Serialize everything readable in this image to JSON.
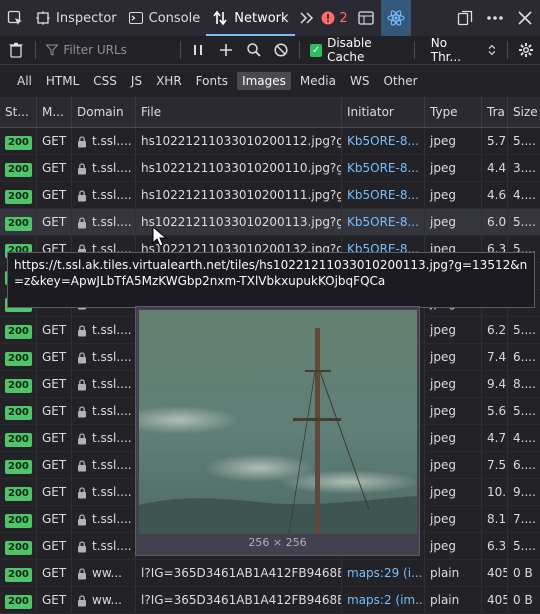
{
  "devtools": {
    "tabs": [
      {
        "label": "Inspector"
      },
      {
        "label": "Console"
      },
      {
        "label": "Network"
      }
    ],
    "error_count": "2"
  },
  "toolbar": {
    "filter_placeholder": "Filter URLs",
    "disable_cache_label": "Disable Cache",
    "throttle_label": "No Thr..."
  },
  "filters": [
    "All",
    "HTML",
    "CSS",
    "JS",
    "XHR",
    "Fonts",
    "Images",
    "Media",
    "WS",
    "Other"
  ],
  "active_filter": "Images",
  "columns": [
    "St...",
    "M...",
    "Domain",
    "File",
    "Initiator",
    "Type",
    "Tra",
    "Size"
  ],
  "rows": [
    {
      "status": "200",
      "method": "GET",
      "domain": "t.ssl....",
      "file": "hs10221211033010200112.jpg?g=13",
      "initiator": "Kb5ORE-8...",
      "type": "jpeg",
      "transferred": "5.7",
      "size": "5...."
    },
    {
      "status": "200",
      "method": "GET",
      "domain": "t.ssl....",
      "file": "hs10221211033010200110.jpg?g=13",
      "initiator": "Kb5ORE-8...",
      "type": "jpeg",
      "transferred": "4.4",
      "size": "3...."
    },
    {
      "status": "200",
      "method": "GET",
      "domain": "t.ssl....",
      "file": "hs10221211033010200111.jpg?g=13",
      "initiator": "Kb5ORE-8...",
      "type": "jpeg",
      "transferred": "4.6",
      "size": "4...."
    },
    {
      "status": "200",
      "method": "GET",
      "domain": "t.ssl....",
      "file": "hs10221211033010200113.jpg?g=13",
      "initiator": "Kb5ORE-8...",
      "type": "jpeg",
      "transferred": "6.0",
      "size": "5...."
    },
    {
      "status": "200",
      "method": "GET",
      "domain": "t.ssl....",
      "file": "hs10221211033010200132.jpg?g=13",
      "initiator": "Kb5ORE-8...",
      "type": "jpeg",
      "transferred": "6.3",
      "size": "5...."
    },
    {
      "status": "200",
      "method": "GET",
      "domain": "t.ssl....",
      "file": "",
      "initiator": "",
      "type": "jpeg",
      "transferred": "",
      "size": ""
    },
    {
      "status": "200",
      "method": "GET",
      "domain": "t.ssl....",
      "file": "",
      "initiator": "",
      "type": "jpeg",
      "transferred": "",
      "size": ""
    },
    {
      "status": "200",
      "method": "GET",
      "domain": "t.ssl....",
      "file": "",
      "initiator": "",
      "type": "jpeg",
      "transferred": "6.2",
      "size": "5...."
    },
    {
      "status": "200",
      "method": "GET",
      "domain": "t.ssl....",
      "file": "",
      "initiator": "",
      "type": "jpeg",
      "transferred": "7.4",
      "size": "6...."
    },
    {
      "status": "200",
      "method": "GET",
      "domain": "t.ssl....",
      "file": "",
      "initiator": "",
      "type": "jpeg",
      "transferred": "9.4",
      "size": "8...."
    },
    {
      "status": "200",
      "method": "GET",
      "domain": "t.ssl....",
      "file": "",
      "initiator": "",
      "type": "jpeg",
      "transferred": "5.6",
      "size": "5...."
    },
    {
      "status": "200",
      "method": "GET",
      "domain": "t.ssl....",
      "file": "",
      "initiator": "",
      "type": "jpeg",
      "transferred": "4.7",
      "size": "4...."
    },
    {
      "status": "200",
      "method": "GET",
      "domain": "t.ssl....",
      "file": "",
      "initiator": "",
      "type": "jpeg",
      "transferred": "7.5",
      "size": "6...."
    },
    {
      "status": "200",
      "method": "GET",
      "domain": "t.ssl....",
      "file": "",
      "initiator": "",
      "type": "jpeg",
      "transferred": "10.",
      "size": "9...."
    },
    {
      "status": "200",
      "method": "GET",
      "domain": "t.ssl....",
      "file": "",
      "initiator": "",
      "type": "jpeg",
      "transferred": "8.1",
      "size": "7...."
    },
    {
      "status": "200",
      "method": "GET",
      "domain": "t.ssl....",
      "file": "",
      "initiator": "",
      "type": "jpeg",
      "transferred": "6.3",
      "size": "5...."
    },
    {
      "status": "200",
      "method": "GET",
      "domain": "ww...",
      "file": "l?IG=365D3461AB1A412FB9468B1C",
      "initiator": "maps:29 (i...",
      "type": "plain",
      "transferred": "405",
      "size": "0 B"
    },
    {
      "status": "200",
      "method": "GET",
      "domain": "ww...",
      "file": "l?IG=365D3461AB1A412FB9468B1C",
      "initiator": "maps:2 (im...",
      "type": "plain",
      "transferred": "405",
      "size": "0 B"
    }
  ],
  "tooltip": {
    "url": "https://t.ssl.ak.tiles.virtualearth.net/tiles/hs10221211033010200113.jpg?g=13512&n=z&key=ApwJLbTfA5MzKWGbp2nxm-TXlVbkxupukKOjbqFQCa"
  },
  "preview": {
    "dimensions": "256 × 256"
  },
  "colors": {
    "accent": "#75bfff",
    "status_ok": "#51c36a",
    "checkbox": "#2fbf5f",
    "error": "#ff6b6b"
  }
}
